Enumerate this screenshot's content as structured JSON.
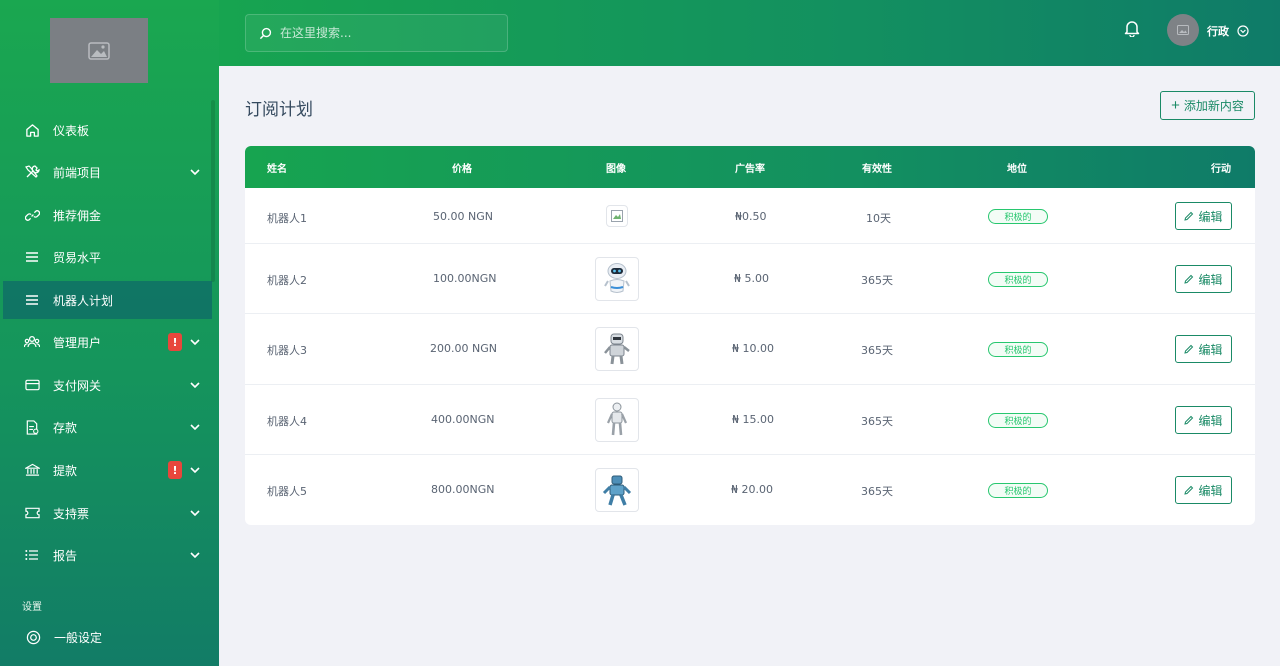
{
  "search": {
    "placeholder": "在这里搜索..."
  },
  "user": {
    "name": "行政"
  },
  "sidebar": {
    "items": [
      {
        "label": "仪表板",
        "icon": "home-icon"
      },
      {
        "label": "前端项目",
        "icon": "tools-icon"
      },
      {
        "label": "推荐佣金",
        "icon": "link-icon"
      },
      {
        "label": "贸易水平",
        "icon": "menu-icon"
      },
      {
        "label": "机器人计划",
        "icon": "menu-icon"
      },
      {
        "label": "管理用户",
        "icon": "users-icon",
        "badge": "!"
      },
      {
        "label": "支付网关",
        "icon": "credit-card-icon"
      },
      {
        "label": "存款",
        "icon": "file-icon"
      },
      {
        "label": "提款",
        "icon": "bank-icon",
        "badge": "!"
      },
      {
        "label": "支持票",
        "icon": "ticket-icon"
      },
      {
        "label": "报告",
        "icon": "list-icon"
      }
    ],
    "section_title": "设置",
    "settings_item": {
      "label": "一般设定",
      "icon": "lifebuoy-icon"
    }
  },
  "page": {
    "title": "订阅计划",
    "add_button": "添加新内容"
  },
  "table": {
    "headers": [
      "姓名",
      "价格",
      "图像",
      "广告率",
      "有效性",
      "地位",
      "行动"
    ],
    "rows": [
      {
        "name": "机器人1",
        "price": "50.00 NGN",
        "rate": "₦0.50",
        "validity": "10天",
        "status": "积极的",
        "action": "编辑"
      },
      {
        "name": "机器人2",
        "price": "100.00NGN",
        "rate": "₦ 5.00",
        "validity": "365天",
        "status": "积极的",
        "action": "编辑"
      },
      {
        "name": "机器人3",
        "price": "200.00 NGN",
        "rate": "₦ 10.00",
        "validity": "365天",
        "status": "积极的",
        "action": "编辑"
      },
      {
        "name": "机器人4",
        "price": "400.00NGN",
        "rate": "₦ 15.00",
        "validity": "365天",
        "status": "积极的",
        "action": "编辑"
      },
      {
        "name": "机器人5",
        "price": "800.00NGN",
        "rate": "₦ 20.00",
        "validity": "365天",
        "status": "积极的",
        "action": "编辑"
      }
    ]
  },
  "colors": {
    "sidebar_green": "#1aa750",
    "teal": "#0f7b68",
    "accent": "#1a8a66",
    "status_green": "#28c76f",
    "alert_red": "#e8463c"
  }
}
